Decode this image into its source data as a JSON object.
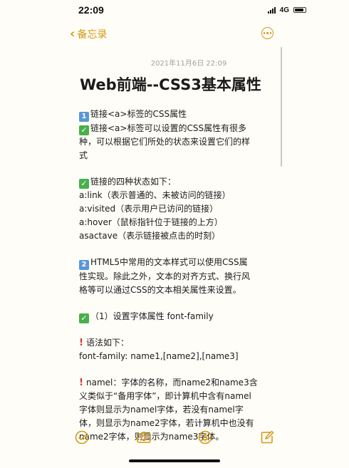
{
  "status": {
    "time": "22:09",
    "network": "4G"
  },
  "nav": {
    "back_label": "备忘录"
  },
  "note": {
    "date": "2021年11月6日 22:09",
    "title": "Web前端--CSS3基本属性",
    "sections": [
      {
        "lines": [
          {
            "marker": "1",
            "text": "链接<a>标签的CSS属性"
          },
          {
            "marker": "check",
            "text": "链接<a>标签可以设置的CSS属性有很多"
          },
          {
            "marker": "",
            "text": "种，可以根据它们所处的状态来设置它们的样"
          },
          {
            "marker": "",
            "text": "式"
          }
        ]
      },
      {
        "lines": [
          {
            "marker": "check",
            "text": "链接的四种状态如下："
          },
          {
            "marker": "",
            "text": "a:link（表示普通的、未被访问的链接）"
          },
          {
            "marker": "",
            "text": "a:visited（表示用户已访问的链接）"
          },
          {
            "marker": "",
            "text": "a:hover（鼠标指针位于链接的上方）"
          },
          {
            "marker": "",
            "text": "asactave（表示链接被点击的时刻）"
          }
        ]
      },
      {
        "lines": [
          {
            "marker": "2",
            "text": "HTML5中常用的文本样式可以使用CSS属"
          },
          {
            "marker": "",
            "text": "性实现。除此之外，文本的对齐方式、换行风"
          },
          {
            "marker": "",
            "text": "格等可以通过CSS的文本相关属性来设置。"
          }
        ]
      },
      {
        "lines": [
          {
            "marker": "check",
            "text": "（1）设置字体属性 font-family"
          }
        ]
      },
      {
        "lines": [
          {
            "marker": "excl",
            "text": "语法如下："
          },
          {
            "marker": "",
            "text": "font-family: name1,[name2],[name3]"
          }
        ]
      },
      {
        "lines": [
          {
            "marker": "excl",
            "text": "namel：字体的名称，而name2和name3含"
          },
          {
            "marker": "",
            "text": "义类似于“备用字体”，即计算机中含有namel"
          },
          {
            "marker": "",
            "text": "字体则显示为namel字体，若没有namel字"
          },
          {
            "marker": "",
            "text": "体，则显示为name2字体，若计算机中也没有"
          },
          {
            "marker": "",
            "text": "name2字体，则显示为name3字体。"
          }
        ]
      }
    ]
  },
  "toolbar": {
    "items": [
      "checklist-icon",
      "camera-icon",
      "markup-icon",
      "compose-icon"
    ]
  },
  "colors": {
    "accent": "#d29a12",
    "background": "#fffdf8",
    "number_badge": "#5a96d8",
    "check_badge": "#47b04b",
    "exclamation": "#e0342b"
  }
}
